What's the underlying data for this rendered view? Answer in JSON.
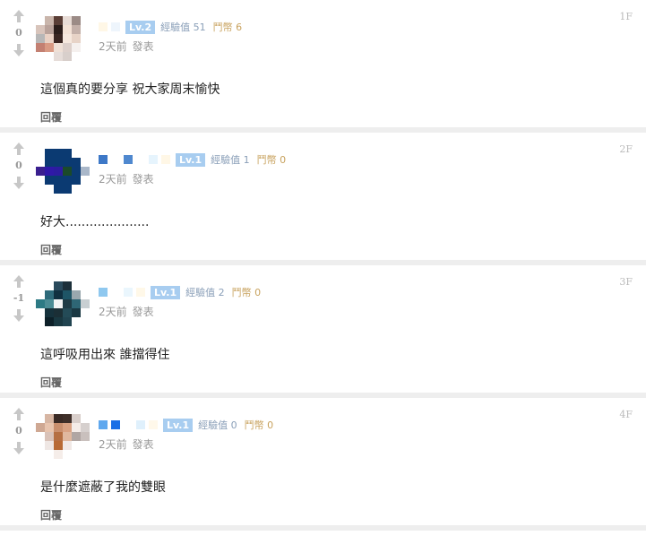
{
  "comments": [
    {
      "floor": "1F",
      "score": "0",
      "level": "Lv.2",
      "exp": "經驗值 51",
      "coins": "鬥幣 6",
      "time": "2天前",
      "posted": "發表",
      "text": "這個真的要分享 祝大家周末愉快",
      "reply": "回覆"
    },
    {
      "floor": "2F",
      "score": "0",
      "level": "Lv.1",
      "exp": "經驗值 1",
      "coins": "鬥幣 0",
      "time": "2天前",
      "posted": "發表",
      "text": "好大.....................",
      "reply": "回覆"
    },
    {
      "floor": "3F",
      "score": "-1",
      "level": "Lv.1",
      "exp": "經驗值 2",
      "coins": "鬥幣 0",
      "time": "2天前",
      "posted": "發表",
      "text": "這呼吸用出來 誰擋得住",
      "reply": "回覆"
    },
    {
      "floor": "4F",
      "score": "0",
      "level": "Lv.1",
      "exp": "經驗值 0",
      "coins": "鬥幣 0",
      "time": "2天前",
      "posted": "發表",
      "text": "是什麼遮蔽了我的雙眼",
      "reply": "回覆"
    }
  ],
  "icons": {
    "upvote": "arrow-up-icon",
    "downvote": "arrow-down-icon"
  },
  "colors": {
    "level_badge": "#a8cdf0",
    "exp_text": "#8a9fb8",
    "coin_text": "#c8a25e",
    "separator": "#eeeeee"
  }
}
